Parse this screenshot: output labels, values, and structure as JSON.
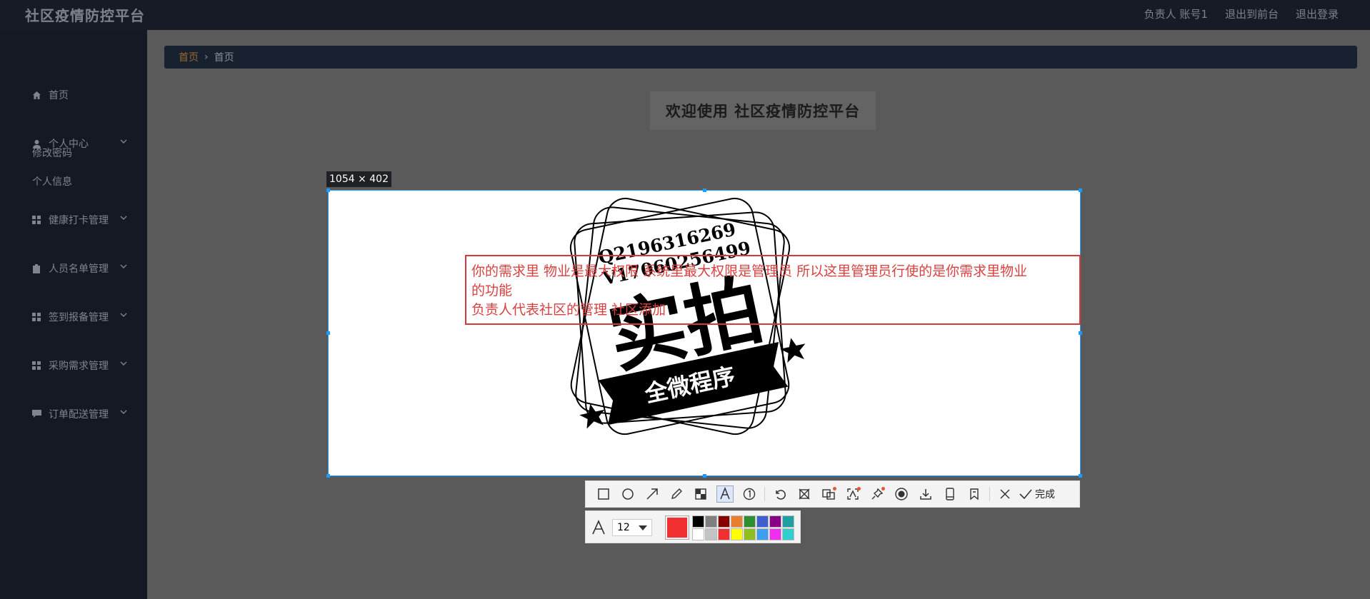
{
  "header": {
    "brand": "社区疫情防控平台",
    "links": [
      "负责人 账号1",
      "退出到前台",
      "退出登录"
    ]
  },
  "sidebar": {
    "items": [
      {
        "label": "首页",
        "icon": "home-icon"
      },
      {
        "label": "个人中心",
        "icon": "user-icon"
      },
      {
        "label": "健康打卡管理",
        "icon": "grid-icon"
      },
      {
        "label": "人员名单管理",
        "icon": "clipboard-icon"
      },
      {
        "label": "签到报备管理",
        "icon": "grid-icon"
      },
      {
        "label": "采购需求管理",
        "icon": "grid-icon"
      },
      {
        "label": "订单配送管理",
        "icon": "chat-icon"
      }
    ],
    "submenu": [
      "修改密码",
      "个人信息"
    ]
  },
  "breadcrumb": {
    "items": [
      "首页",
      "首页"
    ]
  },
  "welcome": "欢迎使用 社区疫情防控平台",
  "screenshot_tool": {
    "dimensions": "1054 × 402",
    "stamp": {
      "line1": "Q2196316269",
      "line2": "V17060256499",
      "big": "实拍",
      "ribbon": "全微程序"
    },
    "annotation_lines": [
      "你的需求里 物业是最大权限 系统里最大权限是管理员 所以这里管理员行使的是你需求里物业",
      "的功能",
      "负责人代表社区的管理 社区添加"
    ],
    "toolbar": {
      "tools": [
        "rectangle-icon",
        "ellipse-icon",
        "arrow-icon",
        "pencil-icon",
        "mosaic-icon",
        "text-icon",
        "number-marker-icon",
        "undo-icon",
        "crop-icon",
        "ocr-icon",
        "scan-icon",
        "pin-icon",
        "record-icon",
        "download-icon",
        "device-icon",
        "bookmark-icon",
        "close-icon"
      ],
      "done_label": "完成"
    },
    "text_options": {
      "font_size": "12",
      "current_color": "#f03030",
      "palette": [
        "#000000",
        "#7f7f7f",
        "#880000",
        "#e87f2f",
        "#2f8f2f",
        "#3f5fcf",
        "#880088",
        "#1f9f9f",
        "#ffffff",
        "#c3c3c3",
        "#f03030",
        "#ffff00",
        "#8fbf1f",
        "#3f9fef",
        "#ef2fef",
        "#2fcfcf"
      ]
    }
  }
}
